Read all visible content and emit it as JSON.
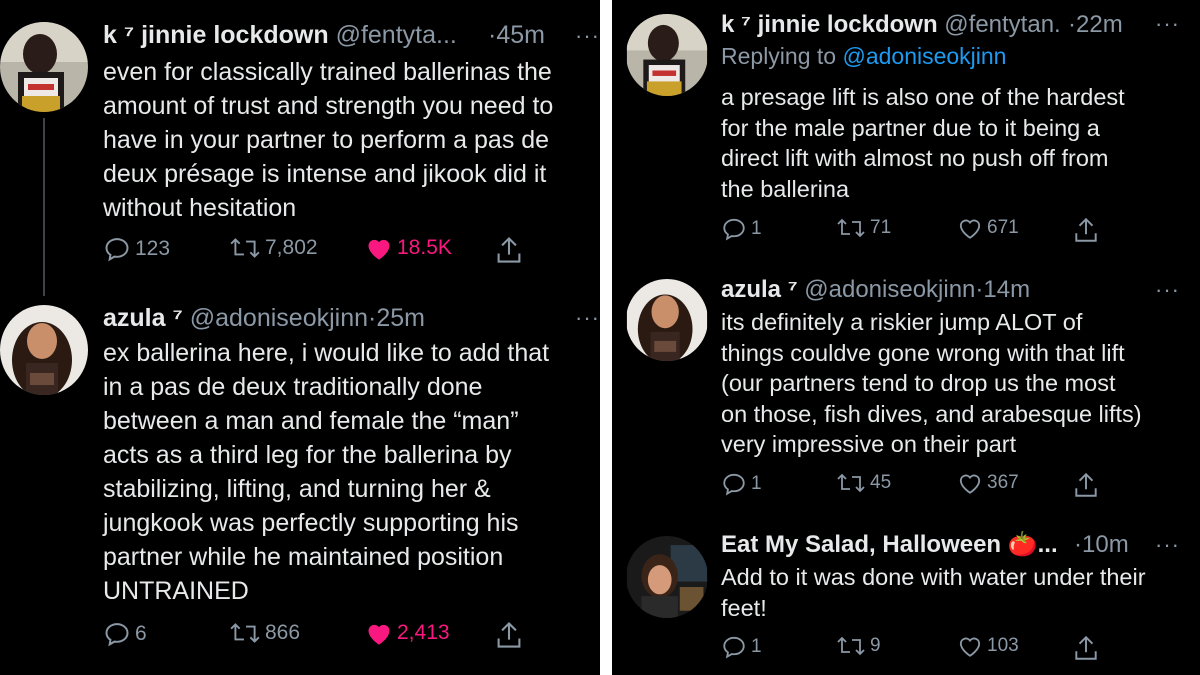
{
  "left": {
    "tweets": [
      {
        "name": "k ⁷ jinnie lockdown",
        "handle": "@fentyta...",
        "separator": "·",
        "time": "45m",
        "text_lines": [
          "even for classically trained ballerinas the",
          "amount of trust and strength you need to",
          "have in your partner to perform a pas de",
          "deux présage is intense and jikook did it",
          "without hesitation"
        ],
        "replies": "123",
        "retweets": "7,802",
        "likes": "18.5K",
        "liked": true
      },
      {
        "name": "azula ⁷",
        "handle": "@adoniseokjinn",
        "separator": "·",
        "time": "25m",
        "text_lines": [
          "ex ballerina here, i would like to add that",
          "in a pas de deux traditionally done",
          "between a man and female the “man”",
          "acts as a third leg for the ballerina by",
          "stabilizing, lifting, and turning her &",
          "jungkook was perfectly supporting his",
          "partner while he maintained position",
          "UNTRAINED"
        ],
        "replies": "6",
        "retweets": "866",
        "likes": "2,413",
        "liked": true
      }
    ]
  },
  "right": {
    "tweets": [
      {
        "name": "k ⁷ jinnie lockdown",
        "handle": "@fentytan...",
        "separator": "·",
        "time": "22m",
        "reply_prefix": "Replying to",
        "reply_mention": "@adoniseokjinn",
        "text_lines": [
          "a presage lift is also one of the hardest",
          "for the male partner due to it being a",
          "direct lift with almost no push off from",
          "the ballerina"
        ],
        "replies": "1",
        "retweets": "71",
        "likes": "671",
        "liked": false
      },
      {
        "name": "azula ⁷",
        "handle": "@adoniseokjinn",
        "separator": "·",
        "time": "14m",
        "text_lines": [
          "its definitely a riskier jump ALOT of",
          "things couldve gone wrong with that lift",
          "(our partners tend to drop us the most",
          "on those, fish dives, and arabesque lifts)",
          "very impressive on their part"
        ],
        "replies": "1",
        "retweets": "45",
        "likes": "367",
        "liked": false
      },
      {
        "name": "Eat My Salad, Halloween 🍅...",
        "handle": "",
        "separator": "·",
        "time": "10m",
        "text_lines": [
          "Add to it was done with water under their",
          "feet!"
        ],
        "replies": "1",
        "retweets": "9",
        "likes": "103",
        "liked": false
      }
    ]
  },
  "icons": {
    "reply": "speech-bubble-icon",
    "retweet": "retweet-arrows-icon",
    "like": "heart-icon",
    "share": "share-upload-icon",
    "more": "more-dots-icon"
  },
  "colors": {
    "background": "#000000",
    "text": "#e7e9ea",
    "muted": "#8b98a5",
    "like": "#f91880",
    "link": "#1d9bf0",
    "divider": "#ffffff"
  }
}
